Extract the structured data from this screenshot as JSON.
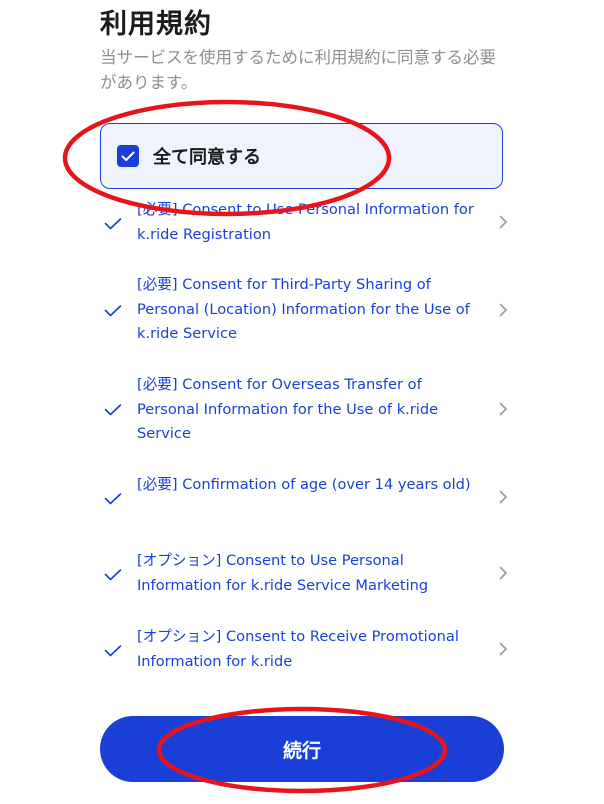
{
  "header": {
    "title": "利用規約",
    "subtitle": "当サービスを使用するために利用規約に同意する必要があります。"
  },
  "agree_all": {
    "label": "全て同意する",
    "checked": true,
    "icon": "checkbox-checked-icon"
  },
  "terms": [
    {
      "text": "[必要] Consent to Use Personal Information for k.ride Registration",
      "checked": true
    },
    {
      "text": "[必要] Consent for Third-Party Sharing of Personal (Location) Information for the Use of k.ride Service",
      "checked": true
    },
    {
      "text": "[必要] Consent for Overseas Transfer of Personal Information for the Use of k.ride Service",
      "checked": true
    },
    {
      "text": "[必要] Confirmation of age (over 14 years old)",
      "checked": true
    },
    {
      "text": "[オプション] Consent to Use Personal Information for k.ride Service Marketing",
      "checked": true
    },
    {
      "text": "[オプション] Consent to Receive Promotional Information for k.ride",
      "checked": true
    }
  ],
  "continue_button": {
    "label": "続行"
  },
  "colors": {
    "accent": "#1a3fd6",
    "agree_bg": "#eef3fc",
    "annotation_red": "#e8141b",
    "subtitle_gray": "#8e8e93",
    "chevron_gray": "#9a9aa0"
  }
}
